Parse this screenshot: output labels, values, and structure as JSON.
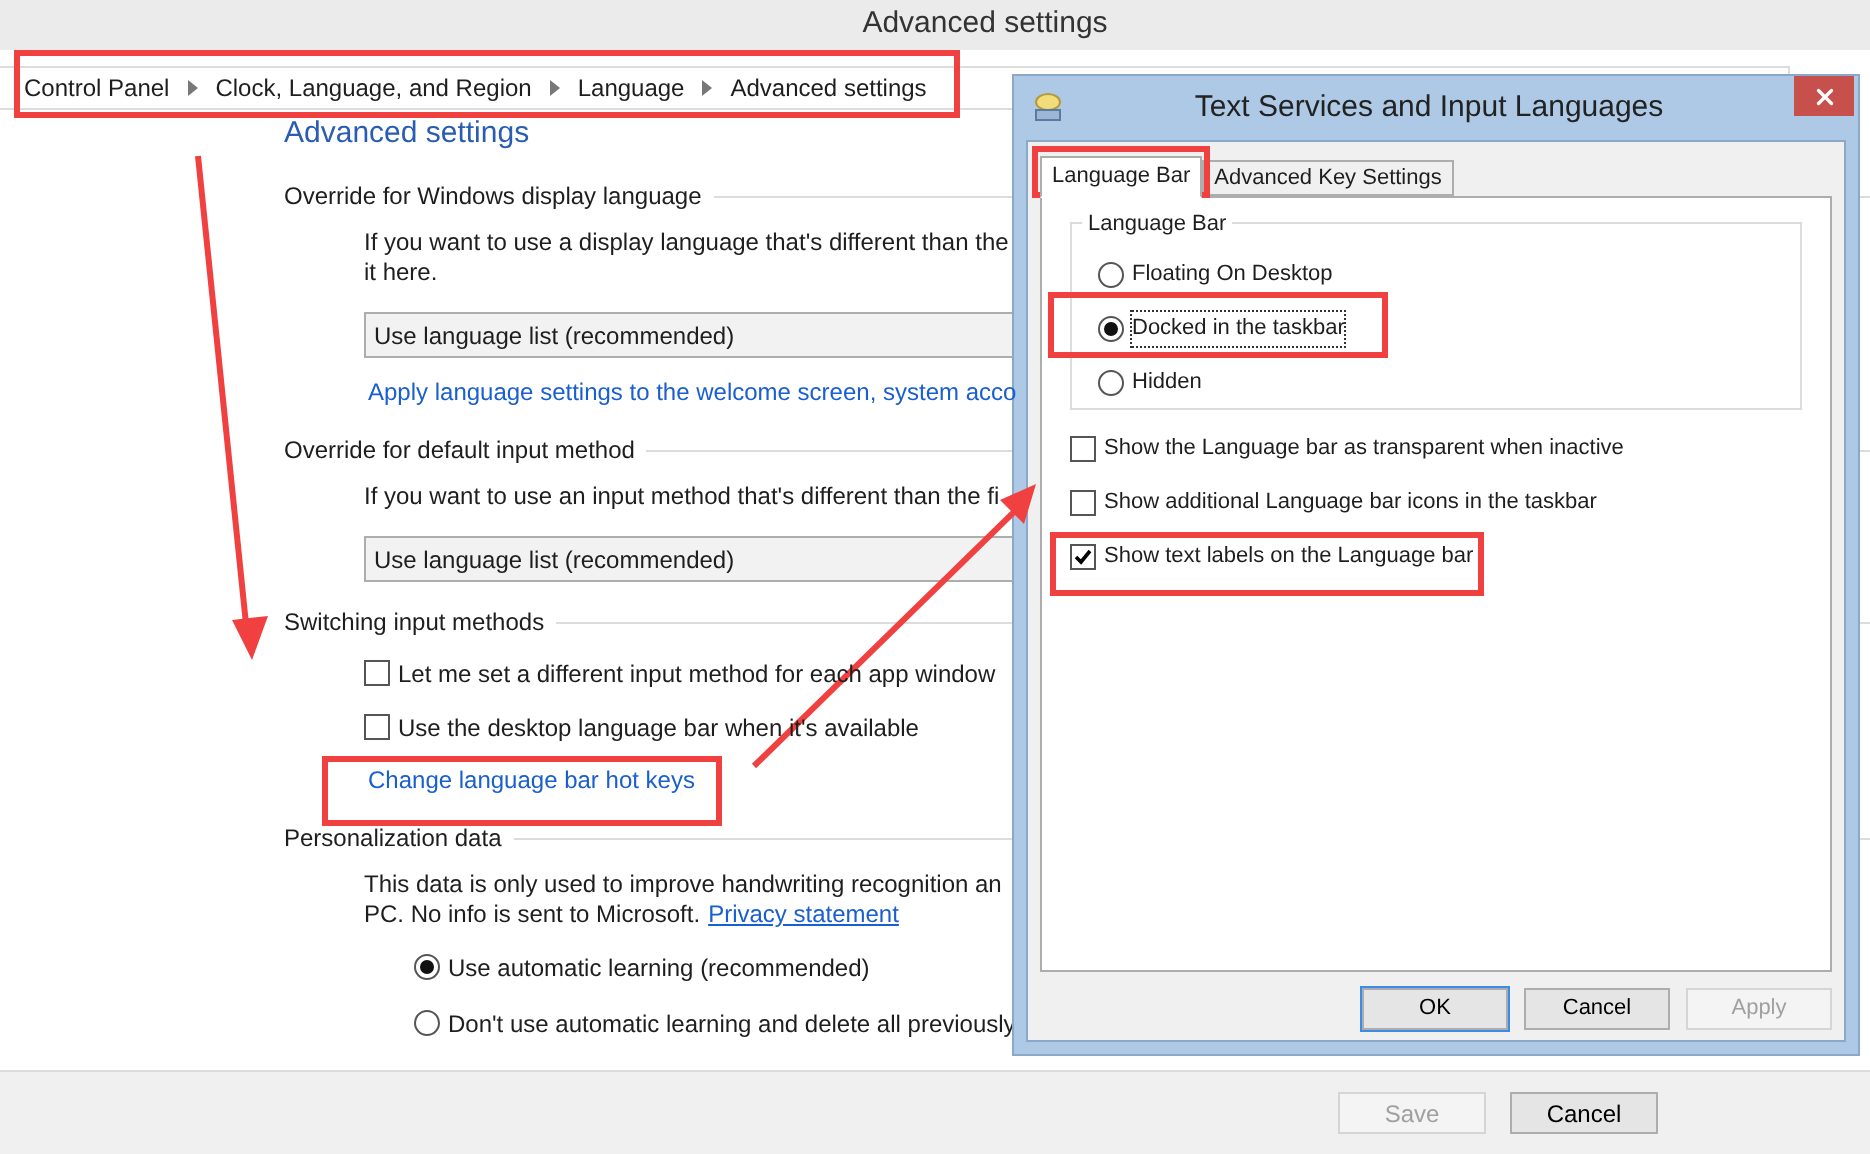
{
  "window": {
    "title": "Advanced settings"
  },
  "breadcrumb": [
    "Control Panel",
    "Clock, Language, and Region",
    "Language",
    "Advanced settings"
  ],
  "page_heading": "Advanced settings",
  "sections": [
    {
      "heading": "Override for Windows display language",
      "items": [
        {
          "kind": "text",
          "lines": [
            "If you want to use a display language that's different than the",
            "it here."
          ]
        },
        {
          "kind": "dropdown",
          "value": "Use language list (recommended)"
        },
        {
          "kind": "link",
          "label": "Apply language settings to the welcome screen, system acco"
        }
      ]
    },
    {
      "heading": "Override for default input method",
      "items": [
        {
          "kind": "text",
          "lines": [
            "If you want to use an input method that's different than the fi"
          ]
        },
        {
          "kind": "dropdown",
          "value": "Use language list (recommended)"
        }
      ]
    },
    {
      "heading": "Switching input methods",
      "items": [
        {
          "kind": "checkbox",
          "label": "Let me set a different input method for each app window",
          "checked": false
        },
        {
          "kind": "checkbox",
          "label": "Use the desktop language bar when it's available",
          "checked": false
        },
        {
          "kind": "link",
          "label": "Change language bar hot keys"
        }
      ]
    },
    {
      "heading": "Personalization data",
      "items": [
        {
          "kind": "text",
          "lines": [
            "This data is only used to improve handwriting recognition an",
            "PC. No info is sent to Microsoft."
          ],
          "link": "Privacy statement"
        },
        {
          "kind": "radio",
          "label": "Use automatic learning (recommended)",
          "selected": true
        },
        {
          "kind": "radio",
          "label": "Don't use automatic learning and delete all previously",
          "selected": false
        }
      ]
    }
  ],
  "footer_buttons": [
    {
      "label": "Save",
      "disabled": true
    },
    {
      "label": "Cancel",
      "disabled": false
    }
  ],
  "dialog": {
    "title": "Text Services and Input Languages",
    "tabs": [
      {
        "label": "Language Bar",
        "selected": true
      },
      {
        "label": "Advanced Key Settings",
        "selected": false
      }
    ],
    "group": {
      "label": "Language Bar",
      "options": [
        {
          "label": "Floating On Desktop",
          "selected": false
        },
        {
          "label": "Docked in the taskbar",
          "selected": true
        },
        {
          "label": "Hidden",
          "selected": false
        }
      ]
    },
    "checkboxes": [
      {
        "label": "Show the Language bar as transparent when inactive",
        "checked": false
      },
      {
        "label": "Show additional Language bar icons in the taskbar",
        "checked": false
      },
      {
        "label": "Show text labels on the Language bar",
        "checked": true
      }
    ],
    "buttons": [
      {
        "label": "OK",
        "disabled": false
      },
      {
        "label": "Cancel",
        "disabled": false
      },
      {
        "label": "Apply",
        "disabled": true
      }
    ]
  }
}
